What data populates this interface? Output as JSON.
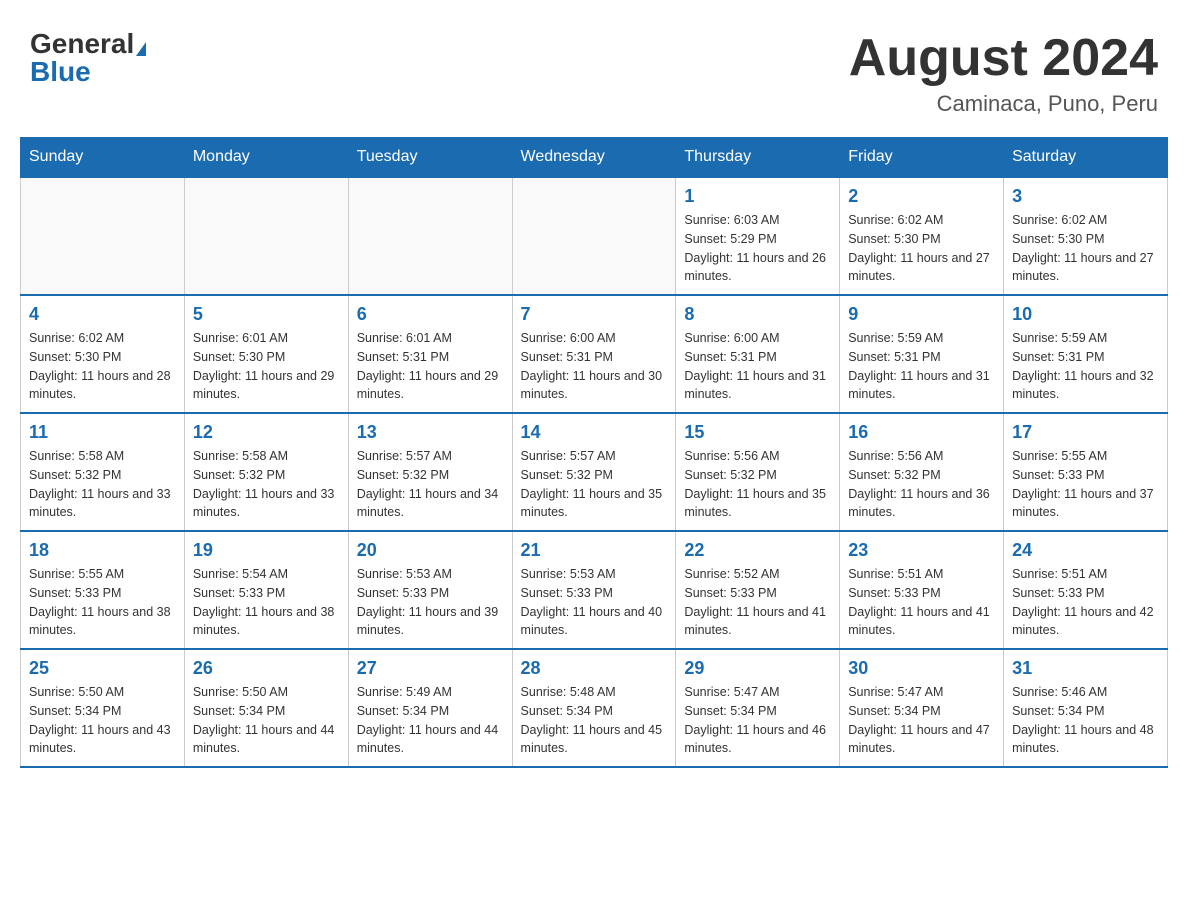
{
  "header": {
    "logo_general": "General",
    "logo_blue": "Blue",
    "title": "August 2024",
    "location": "Caminaca, Puno, Peru"
  },
  "weekdays": [
    "Sunday",
    "Monday",
    "Tuesday",
    "Wednesday",
    "Thursday",
    "Friday",
    "Saturday"
  ],
  "weeks": [
    {
      "days": [
        {
          "num": "",
          "info": ""
        },
        {
          "num": "",
          "info": ""
        },
        {
          "num": "",
          "info": ""
        },
        {
          "num": "",
          "info": ""
        },
        {
          "num": "1",
          "info": "Sunrise: 6:03 AM\nSunset: 5:29 PM\nDaylight: 11 hours and 26 minutes."
        },
        {
          "num": "2",
          "info": "Sunrise: 6:02 AM\nSunset: 5:30 PM\nDaylight: 11 hours and 27 minutes."
        },
        {
          "num": "3",
          "info": "Sunrise: 6:02 AM\nSunset: 5:30 PM\nDaylight: 11 hours and 27 minutes."
        }
      ]
    },
    {
      "days": [
        {
          "num": "4",
          "info": "Sunrise: 6:02 AM\nSunset: 5:30 PM\nDaylight: 11 hours and 28 minutes."
        },
        {
          "num": "5",
          "info": "Sunrise: 6:01 AM\nSunset: 5:30 PM\nDaylight: 11 hours and 29 minutes."
        },
        {
          "num": "6",
          "info": "Sunrise: 6:01 AM\nSunset: 5:31 PM\nDaylight: 11 hours and 29 minutes."
        },
        {
          "num": "7",
          "info": "Sunrise: 6:00 AM\nSunset: 5:31 PM\nDaylight: 11 hours and 30 minutes."
        },
        {
          "num": "8",
          "info": "Sunrise: 6:00 AM\nSunset: 5:31 PM\nDaylight: 11 hours and 31 minutes."
        },
        {
          "num": "9",
          "info": "Sunrise: 5:59 AM\nSunset: 5:31 PM\nDaylight: 11 hours and 31 minutes."
        },
        {
          "num": "10",
          "info": "Sunrise: 5:59 AM\nSunset: 5:31 PM\nDaylight: 11 hours and 32 minutes."
        }
      ]
    },
    {
      "days": [
        {
          "num": "11",
          "info": "Sunrise: 5:58 AM\nSunset: 5:32 PM\nDaylight: 11 hours and 33 minutes."
        },
        {
          "num": "12",
          "info": "Sunrise: 5:58 AM\nSunset: 5:32 PM\nDaylight: 11 hours and 33 minutes."
        },
        {
          "num": "13",
          "info": "Sunrise: 5:57 AM\nSunset: 5:32 PM\nDaylight: 11 hours and 34 minutes."
        },
        {
          "num": "14",
          "info": "Sunrise: 5:57 AM\nSunset: 5:32 PM\nDaylight: 11 hours and 35 minutes."
        },
        {
          "num": "15",
          "info": "Sunrise: 5:56 AM\nSunset: 5:32 PM\nDaylight: 11 hours and 35 minutes."
        },
        {
          "num": "16",
          "info": "Sunrise: 5:56 AM\nSunset: 5:32 PM\nDaylight: 11 hours and 36 minutes."
        },
        {
          "num": "17",
          "info": "Sunrise: 5:55 AM\nSunset: 5:33 PM\nDaylight: 11 hours and 37 minutes."
        }
      ]
    },
    {
      "days": [
        {
          "num": "18",
          "info": "Sunrise: 5:55 AM\nSunset: 5:33 PM\nDaylight: 11 hours and 38 minutes."
        },
        {
          "num": "19",
          "info": "Sunrise: 5:54 AM\nSunset: 5:33 PM\nDaylight: 11 hours and 38 minutes."
        },
        {
          "num": "20",
          "info": "Sunrise: 5:53 AM\nSunset: 5:33 PM\nDaylight: 11 hours and 39 minutes."
        },
        {
          "num": "21",
          "info": "Sunrise: 5:53 AM\nSunset: 5:33 PM\nDaylight: 11 hours and 40 minutes."
        },
        {
          "num": "22",
          "info": "Sunrise: 5:52 AM\nSunset: 5:33 PM\nDaylight: 11 hours and 41 minutes."
        },
        {
          "num": "23",
          "info": "Sunrise: 5:51 AM\nSunset: 5:33 PM\nDaylight: 11 hours and 41 minutes."
        },
        {
          "num": "24",
          "info": "Sunrise: 5:51 AM\nSunset: 5:33 PM\nDaylight: 11 hours and 42 minutes."
        }
      ]
    },
    {
      "days": [
        {
          "num": "25",
          "info": "Sunrise: 5:50 AM\nSunset: 5:34 PM\nDaylight: 11 hours and 43 minutes."
        },
        {
          "num": "26",
          "info": "Sunrise: 5:50 AM\nSunset: 5:34 PM\nDaylight: 11 hours and 44 minutes."
        },
        {
          "num": "27",
          "info": "Sunrise: 5:49 AM\nSunset: 5:34 PM\nDaylight: 11 hours and 44 minutes."
        },
        {
          "num": "28",
          "info": "Sunrise: 5:48 AM\nSunset: 5:34 PM\nDaylight: 11 hours and 45 minutes."
        },
        {
          "num": "29",
          "info": "Sunrise: 5:47 AM\nSunset: 5:34 PM\nDaylight: 11 hours and 46 minutes."
        },
        {
          "num": "30",
          "info": "Sunrise: 5:47 AM\nSunset: 5:34 PM\nDaylight: 11 hours and 47 minutes."
        },
        {
          "num": "31",
          "info": "Sunrise: 5:46 AM\nSunset: 5:34 PM\nDaylight: 11 hours and 48 minutes."
        }
      ]
    }
  ]
}
